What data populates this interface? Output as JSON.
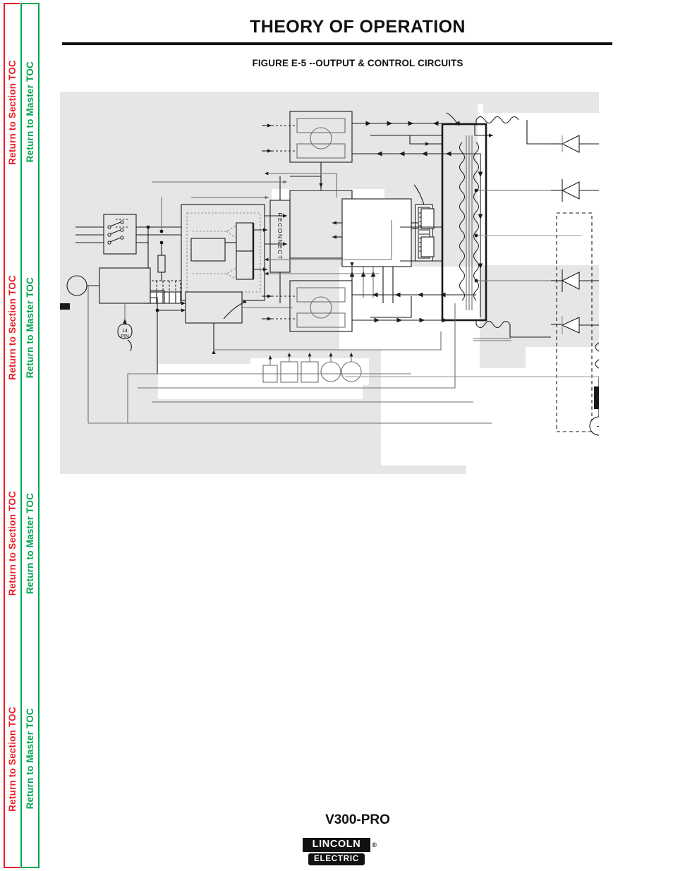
{
  "page": {
    "title": "THEORY OF OPERATION",
    "figure_caption": "FIGURE E-5 --OUTPUT & CONTROL CIRCUITS",
    "model": "V300-PRO",
    "brand_top": "LINCOLN",
    "brand_registered": "®",
    "brand_bottom": "ELECTRIC"
  },
  "nav": {
    "section_toc_label": "Return to Section TOC",
    "master_toc_label": "Return to Master TOC",
    "section_toc_color": "#ed1c24",
    "master_toc_color": "#00a651",
    "repeat_count": 4
  },
  "diagram": {
    "background_color": "#e6e6e6",
    "line_color": "#1a1a1a",
    "faint_line_color": "#8a8a8a",
    "labels": {
      "reconnect": "RECONNECT",
      "connector_14pin_line1": "14",
      "connector_14pin_line2": "PIN",
      "output_negative": "−",
      "output_positive": "+",
      "rectifier_plus": "+",
      "rectifier_minus": "−"
    }
  }
}
